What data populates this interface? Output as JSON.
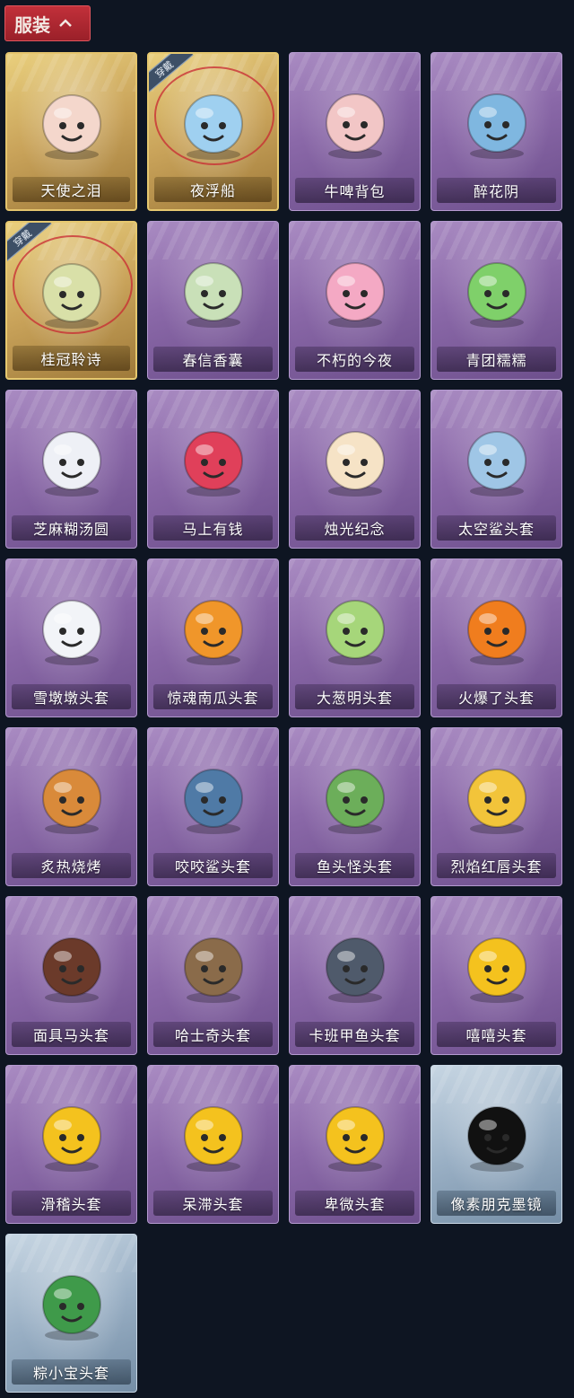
{
  "header": {
    "title": "服装",
    "chevron_icon": "chevron-up-icon"
  },
  "worn_tag": "穿戴",
  "items": [
    {
      "name": "天使之泪",
      "tier": "gold",
      "worn": false,
      "icon": "angel-halo-icon",
      "color": "#f4d7cc"
    },
    {
      "name": "夜浮船",
      "tier": "gold",
      "worn": true,
      "icon": "jellyfish-icon",
      "color": "#9fd0f0"
    },
    {
      "name": "牛啤背包",
      "tier": "purple",
      "worn": false,
      "icon": "cow-barrel-icon",
      "color": "#f2c6c6"
    },
    {
      "name": "醉花阴",
      "tier": "purple",
      "worn": false,
      "icon": "floral-ornament-icon",
      "color": "#7fb7e0"
    },
    {
      "name": "桂冠聆诗",
      "tier": "gold",
      "worn": true,
      "icon": "laurel-doll-icon",
      "color": "#d9e0a8"
    },
    {
      "name": "春信香囊",
      "tier": "purple",
      "worn": false,
      "icon": "sachet-icon",
      "color": "#c9e0b8"
    },
    {
      "name": "不朽的今夜",
      "tier": "purple",
      "worn": false,
      "icon": "pink-cat-cup-icon",
      "color": "#f4a9c4"
    },
    {
      "name": "青团糯糯",
      "tier": "purple",
      "worn": false,
      "icon": "green-dumpling-icon",
      "color": "#7fd06a"
    },
    {
      "name": "芝麻糊汤圆",
      "tier": "purple",
      "worn": false,
      "icon": "white-dumpling-icon",
      "color": "#eef0f6"
    },
    {
      "name": "马上有钱",
      "tier": "purple",
      "worn": false,
      "icon": "red-horse-head-icon",
      "color": "#e0405a"
    },
    {
      "name": "烛光纪念",
      "tier": "purple",
      "worn": false,
      "icon": "candle-icon",
      "color": "#f6e3c6"
    },
    {
      "name": "太空鲨头套",
      "tier": "purple",
      "worn": false,
      "icon": "space-shark-icon",
      "color": "#9fc6e6"
    },
    {
      "name": "雪墩墩头套",
      "tier": "purple",
      "worn": false,
      "icon": "snowman-icon",
      "color": "#f2f4f8"
    },
    {
      "name": "惊魂南瓜头套",
      "tier": "purple",
      "worn": false,
      "icon": "pumpkin-icon",
      "color": "#f0962a"
    },
    {
      "name": "大葱明头套",
      "tier": "purple",
      "worn": false,
      "icon": "scallion-icon",
      "color": "#a6d67a"
    },
    {
      "name": "火爆了头套",
      "tier": "purple",
      "worn": false,
      "icon": "fire-face-icon",
      "color": "#f07d1e"
    },
    {
      "name": "炙热烧烤",
      "tier": "purple",
      "worn": false,
      "icon": "bbq-meat-icon",
      "color": "#d98a3a"
    },
    {
      "name": "咬咬鲨头套",
      "tier": "purple",
      "worn": false,
      "icon": "shark-head-icon",
      "color": "#4f7aa6"
    },
    {
      "name": "鱼头怪头套",
      "tier": "purple",
      "worn": false,
      "icon": "fish-monster-icon",
      "color": "#6cae5a"
    },
    {
      "name": "烈焰红唇头套",
      "tier": "purple",
      "worn": false,
      "icon": "yellow-pikachu-mask-icon",
      "color": "#f2c43a"
    },
    {
      "name": "面具马头套",
      "tier": "purple",
      "worn": false,
      "icon": "horse-mask-icon",
      "color": "#6b3a2a"
    },
    {
      "name": "哈士奇头套",
      "tier": "purple",
      "worn": false,
      "icon": "husky-sunglasses-icon",
      "color": "#8a6b4a"
    },
    {
      "name": "卡班甲鱼头套",
      "tier": "purple",
      "worn": false,
      "icon": "pufferfish-icon",
      "color": "#4f5a6b"
    },
    {
      "name": "嘻嘻头套",
      "tier": "purple",
      "worn": false,
      "icon": "grin-emoji-icon",
      "color": "#f4c21e"
    },
    {
      "name": "滑稽头套",
      "tier": "purple",
      "worn": false,
      "icon": "smug-emoji-icon",
      "color": "#f4c21e"
    },
    {
      "name": "呆滞头套",
      "tier": "purple",
      "worn": false,
      "icon": "blank-stare-emoji-icon",
      "color": "#f4c21e"
    },
    {
      "name": "卑微头套",
      "tier": "purple",
      "worn": false,
      "icon": "pleading-emoji-icon",
      "color": "#f4c21e"
    },
    {
      "name": "像素朋克墨镜",
      "tier": "blue",
      "worn": false,
      "icon": "pixel-sunglasses-icon",
      "color": "#111111"
    },
    {
      "name": "粽小宝头套",
      "tier": "blue",
      "worn": false,
      "icon": "zongzi-head-icon",
      "color": "#3f9a4a"
    }
  ]
}
